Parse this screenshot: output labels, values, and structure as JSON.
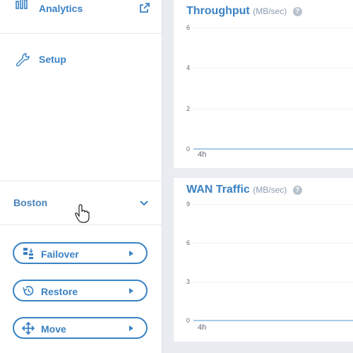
{
  "sidebar": {
    "nav": [
      {
        "label": "Analytics",
        "icon": "bar-chart-icon",
        "external": true
      },
      {
        "label": "Setup",
        "icon": "wrench-icon"
      }
    ],
    "site": {
      "label": "Boston",
      "expanded": false
    },
    "actions": [
      {
        "label": "Failover",
        "icon": "failover-icon"
      },
      {
        "label": "Restore",
        "icon": "restore-history-icon"
      },
      {
        "label": "Move",
        "icon": "move-arrows-icon"
      }
    ]
  },
  "colors": {
    "accent": "#3a82c4",
    "background": "#e9ecf1",
    "line": "#a8cbe8"
  },
  "chart_data": [
    {
      "type": "line",
      "title": "Throughput",
      "unit": "(MB/sec)",
      "y_ticks": [
        "6",
        "4",
        "2",
        "0"
      ],
      "x_ticks": [
        "4h"
      ],
      "ylim": [
        0,
        6
      ],
      "series": [
        {
          "values": [
            0,
            0
          ]
        }
      ]
    },
    {
      "type": "line",
      "title": "WAN Traffic",
      "unit": "(MB/sec)",
      "y_ticks": [
        "9",
        "6",
        "3",
        "0"
      ],
      "x_ticks": [
        "4h"
      ],
      "ylim": [
        0,
        9
      ],
      "series": [
        {
          "values": [
            0,
            0
          ]
        }
      ]
    }
  ]
}
